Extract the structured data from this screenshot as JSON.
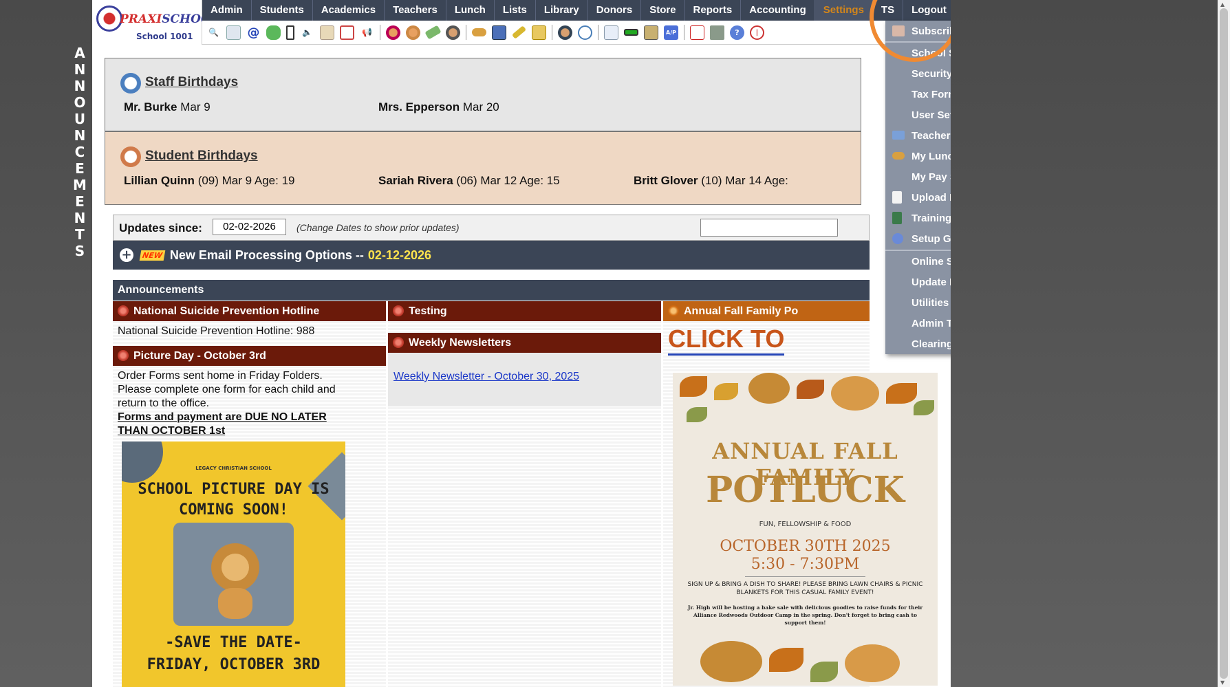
{
  "sidebar": {
    "vertical_text": [
      "A",
      "N",
      "N",
      "O",
      "U",
      "N",
      "C",
      "E",
      "M",
      "E",
      "N",
      "T",
      "S"
    ]
  },
  "logo": {
    "brand_praxi": "PRAXI",
    "brand_school": "SCHOOL",
    "tm": "™",
    "school_name": "School 1001"
  },
  "nav": {
    "items": [
      "Admin",
      "Students",
      "Academics",
      "Teachers",
      "Lunch",
      "Lists",
      "Library",
      "Donors",
      "Store",
      "Reports",
      "Accounting",
      "Settings",
      "TS",
      "Logout"
    ]
  },
  "toolbar": {
    "icons": [
      "search-icon",
      "calendar-grid-icon",
      "at-icon",
      "chat-icon",
      "mobile-icon",
      "speaker-icon",
      "report-icon",
      "calendar-icon",
      "megaphone-icon",
      "teacher-icon",
      "student-icon",
      "tag-icon",
      "people-icon",
      "lunch-icon",
      "book-icon",
      "pencil-icon",
      "mail-icon",
      "staff-icon",
      "clock-icon",
      "spreadsheet-icon",
      "card-icon",
      "print-icon",
      "ap-icon",
      "pdf-icon",
      "stack-icon",
      "help-icon",
      "power-icon"
    ]
  },
  "staff_birthdays": {
    "title": "Staff Birthdays",
    "entries": [
      {
        "name": "Mr. Burke",
        "detail": "Mar 9"
      },
      {
        "name": "Mrs. Epperson",
        "detail": "Mar 20"
      }
    ]
  },
  "student_birthdays": {
    "title": "Student Birthdays",
    "entries": [
      {
        "name": "Lillian Quinn",
        "detail": "(09) Mar 9 Age: 19"
      },
      {
        "name": "Sariah Rivera",
        "detail": "(06) Mar 12 Age: 15"
      },
      {
        "name": "Britt Glover",
        "detail": "(10) Mar 14 Age:"
      }
    ]
  },
  "updates": {
    "label": "Updates since:",
    "date_value": "02-02-2026",
    "hint": "(Change Dates to show prior updates)",
    "search_value": ""
  },
  "email_bar": {
    "new_badge": "NEW",
    "title": "New Email Processing Options --",
    "date": "02-12-2026"
  },
  "announcements": {
    "header": "Announcements",
    "col1": {
      "item1_title": "National Suicide Prevention Hotline",
      "item1_text": "National Suicide Prevention Hotline: 988",
      "item2_title": "Picture Day - October 3rd",
      "item2_text": "Order Forms sent home in Friday Folders. Please complete one form for each child and return to the office.",
      "item2_link": "Forms and payment are DUE NO LATER THAN OCTOBER 1st",
      "poster_school": "LEGACY CHRISTIAN SCHOOL",
      "poster_headline": "SCHOOL PICTURE DAY IS COMING SOON!",
      "poster_save": "-SAVE THE DATE-",
      "poster_date": "FRIDAY, OCTOBER 3RD"
    },
    "col2": {
      "item1_title": "Testing",
      "item2_title": "Weekly Newsletters",
      "item2_link": "Weekly Newsletter - October 30, 2025"
    },
    "col3": {
      "item1_title": "Annual Fall Family Po",
      "click_text": "CLICK TO",
      "poster_line1": "ANNUAL FALL FAMILY",
      "poster_line2": "POTLUCK",
      "poster_sub": "FUN, FELLOWSHIP & FOOD",
      "poster_date": "OCTOBER 30TH 2025",
      "poster_time": "5:30 - 7:30PM",
      "poster_note": "SIGN UP & BRING A DISH TO SHARE! PLEASE BRING LAWN CHAIRS & PICNIC BLANKETS FOR THIS CASUAL FAMILY EVENT!",
      "poster_fine": "Jr. High will be hosting a bake sale with delicious goodies to raise funds for their Alliance Redwoods Outdoor Camp in the spring. Don't forget to bring cash to support them!"
    }
  },
  "settings_menu": {
    "items": [
      {
        "label": "Subscribe-Update Email",
        "icon": "envelope-icon",
        "arrow": ""
      },
      {
        "label": "School Settings",
        "icon": "",
        "arrow": "⇒"
      },
      {
        "label": "Security Settings",
        "icon": "",
        "arrow": "⇒"
      },
      {
        "label": "Tax Forms",
        "icon": "",
        "arrow": "⇒"
      },
      {
        "label": "User Settings",
        "icon": "",
        "arrow": "⇒"
      },
      {
        "label": "Teacher Html",
        "icon": "html-icon",
        "arrow": ""
      },
      {
        "label": "My Lunch Statement",
        "icon": "burger-icon",
        "arrow": ""
      },
      {
        "label": "My Pay Stubs",
        "icon": "",
        "arrow": ""
      },
      {
        "label": "Upload Personal Docs",
        "icon": "document-icon",
        "arrow": ""
      },
      {
        "label": "Training Videos",
        "icon": "film-icon",
        "arrow": ""
      },
      {
        "label": "Setup Guides",
        "icon": "help-icon",
        "arrow": ""
      },
      {
        "label": "Online Support",
        "icon": "",
        "arrow": ""
      },
      {
        "label": "Update Parent Square",
        "icon": "",
        "arrow": ""
      },
      {
        "label": "Utilities",
        "icon": "",
        "arrow": ""
      },
      {
        "label": "Admin Tasks",
        "icon": "",
        "arrow": "⇒"
      },
      {
        "label": "Clearing Browser Cache",
        "icon": "",
        "arrow": ""
      }
    ]
  },
  "colors": {
    "nav_bg": "#3b4556",
    "announcement_title_bg": "#6b1a0a",
    "highlight": "#f08a32",
    "menu_bg": "#8a93a3"
  }
}
